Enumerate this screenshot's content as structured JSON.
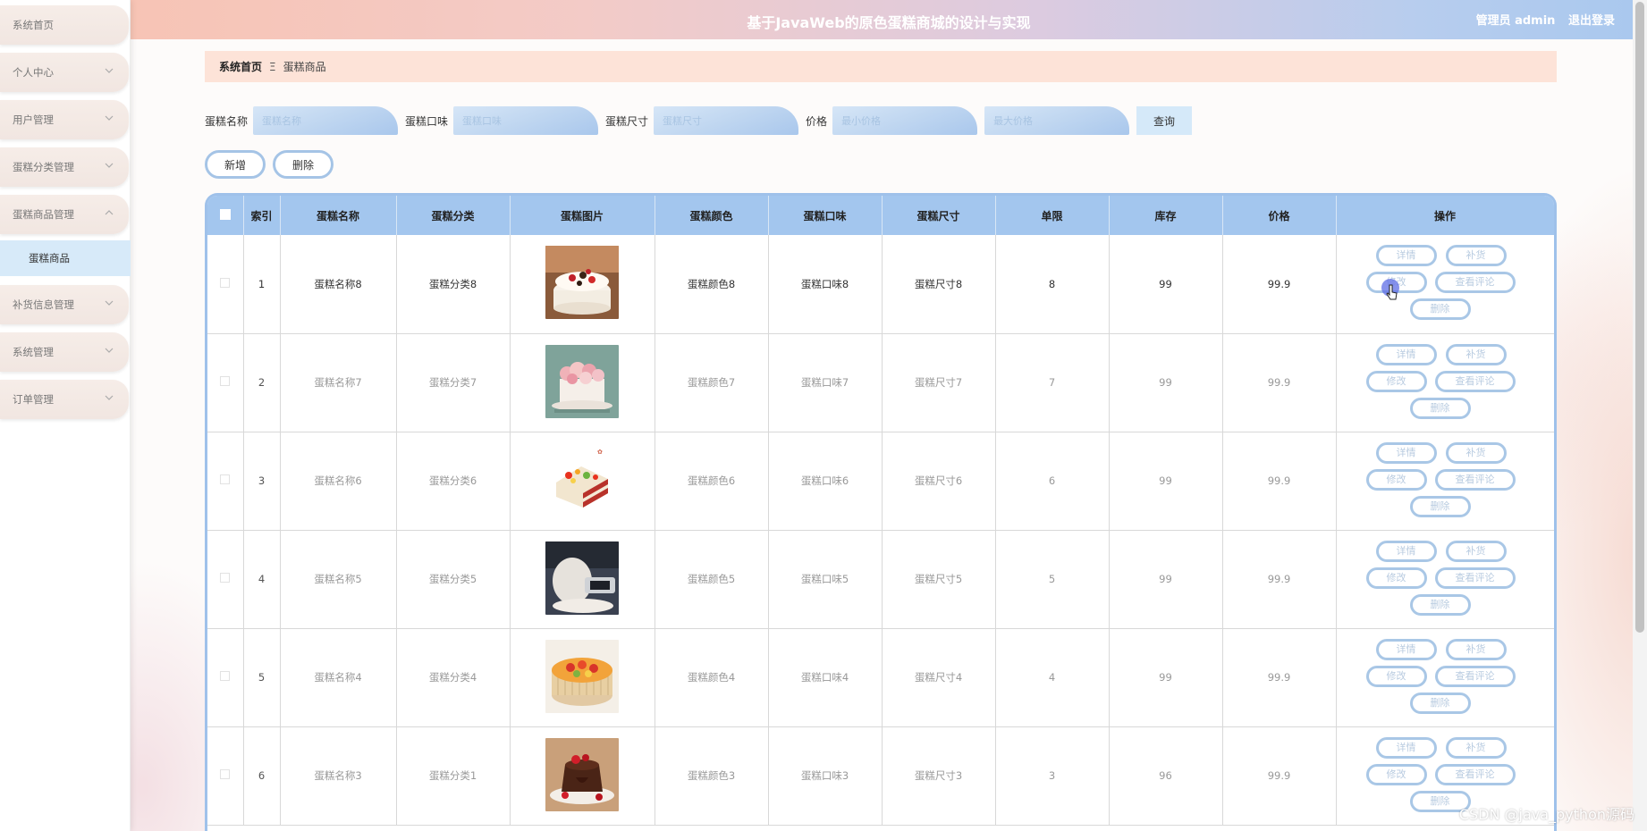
{
  "sidebar": {
    "items": [
      {
        "label": "系统首页",
        "chevron": false
      },
      {
        "label": "个人中心",
        "chevron": true
      },
      {
        "label": "用户管理",
        "chevron": true
      },
      {
        "label": "蛋糕分类管理",
        "chevron": true
      },
      {
        "label": "蛋糕商品管理",
        "chevron": true,
        "expanded": true
      },
      {
        "label": "补货信息管理",
        "chevron": true
      },
      {
        "label": "系统管理",
        "chevron": true
      },
      {
        "label": "订单管理",
        "chevron": true
      }
    ],
    "submenu": {
      "label": "蛋糕商品"
    }
  },
  "header": {
    "title": "基于JavaWeb的原色蛋糕商城的设计与实现",
    "role": "管理员 admin",
    "logout": "退出登录"
  },
  "breadcrumb": {
    "home": "系统首页",
    "separator": "Ξ",
    "current": "蛋糕商品"
  },
  "search": {
    "name_label": "蛋糕名称",
    "name_placeholder": "蛋糕名称",
    "flavor_label": "蛋糕口味",
    "flavor_placeholder": "蛋糕口味",
    "size_label": "蛋糕尺寸",
    "size_placeholder": "蛋糕尺寸",
    "price_label": "价格",
    "min_price_placeholder": "最小价格",
    "max_price_placeholder": "最大价格",
    "query": "查询"
  },
  "actions": {
    "add": "新增",
    "delete": "删除"
  },
  "table": {
    "headers": [
      "索引",
      "蛋糕名称",
      "蛋糕分类",
      "蛋糕图片",
      "蛋糕颜色",
      "蛋糕口味",
      "蛋糕尺寸",
      "单限",
      "库存",
      "价格",
      "操作"
    ],
    "op_labels": {
      "detail": "详情",
      "restock": "补货",
      "edit": "修改",
      "review": "查看评论",
      "delete": "删除"
    },
    "rows": [
      {
        "index": "1",
        "name": "蛋糕名称8",
        "category": "蛋糕分类8",
        "image": "cream-cake-with-chocolate-and-berries",
        "color": "蛋糕颜色8",
        "flavor": "蛋糕口味8",
        "size": "蛋糕尺寸8",
        "limit": "8",
        "stock": "99",
        "price": "99.9"
      },
      {
        "index": "2",
        "name": "蛋糕名称7",
        "category": "蛋糕分类7",
        "image": "pink-rose-cake",
        "color": "蛋糕颜色7",
        "flavor": "蛋糕口味7",
        "size": "蛋糕尺寸7",
        "limit": "7",
        "stock": "99",
        "price": "99.9"
      },
      {
        "index": "3",
        "name": "蛋糕名称6",
        "category": "蛋糕分类6",
        "image": "fruit-layer-cake-slice",
        "color": "蛋糕颜色6",
        "flavor": "蛋糕口味6",
        "size": "蛋糕尺寸6",
        "limit": "6",
        "stock": "99",
        "price": "99.9"
      },
      {
        "index": "4",
        "name": "蛋糕名称5",
        "category": "蛋糕分类5",
        "image": "baking-photo",
        "color": "蛋糕颜色5",
        "flavor": "蛋糕口味5",
        "size": "蛋糕尺寸5",
        "limit": "5",
        "stock": "99",
        "price": "99.9"
      },
      {
        "index": "5",
        "name": "蛋糕名称4",
        "category": "蛋糕分类4",
        "image": "ladyfinger-fruit-cake",
        "color": "蛋糕颜色4",
        "flavor": "蛋糕口味4",
        "size": "蛋糕尺寸4",
        "limit": "4",
        "stock": "99",
        "price": "99.9"
      },
      {
        "index": "6",
        "name": "蛋糕名称3",
        "category": "蛋糕分类1",
        "image": "chocolate-lava-cake",
        "color": "蛋糕颜色3",
        "flavor": "蛋糕口味3",
        "size": "蛋糕尺寸3",
        "limit": "3",
        "stock": "96",
        "price": "99.9"
      }
    ]
  },
  "watermark": "CSDN @java_python源码"
}
